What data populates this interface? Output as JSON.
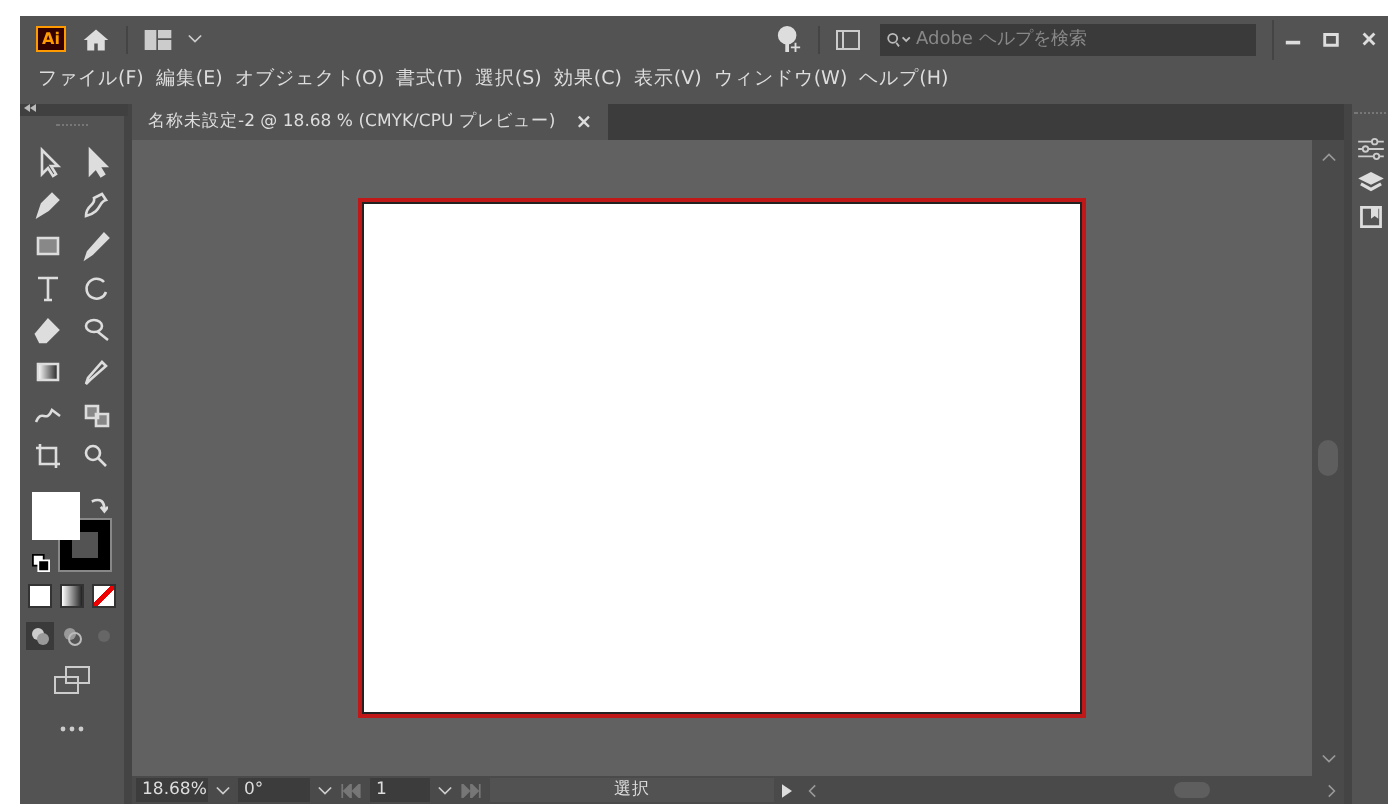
{
  "app_bar": {
    "logo": "Ai",
    "search": {
      "placeholder": "Adobe ヘルプを検索"
    }
  },
  "menu": [
    "ファイル(F)",
    "編集(E)",
    "オブジェクト(O)",
    "書式(T)",
    "選択(S)",
    "効果(C)",
    "表示(V)",
    "ウィンドウ(W)",
    "ヘルプ(H)"
  ],
  "document_tab": {
    "title": "名称未設定-2 @ 18.68 % (CMYK/CPU プレビュー)",
    "close": "×"
  },
  "status_bar": {
    "zoom": "18.68%",
    "rotation": "0°",
    "artboard": "1",
    "tool": "選択"
  }
}
